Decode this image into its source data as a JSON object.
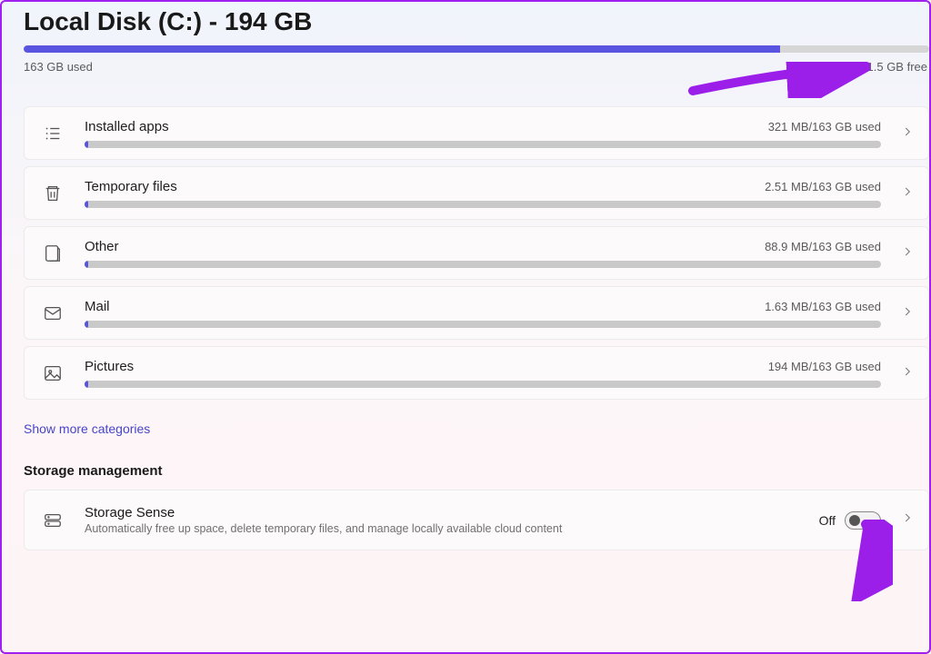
{
  "title": "Local Disk (C:) - 194 GB",
  "usage": {
    "used_label": "163 GB used",
    "free_label": "31.5 GB free",
    "used_pct": 83.5
  },
  "categories": [
    {
      "icon": "apps",
      "name": "Installed apps",
      "value": "321 MB/163 GB used",
      "pct": 0.2
    },
    {
      "icon": "trash",
      "name": "Temporary files",
      "value": "2.51 MB/163 GB used",
      "pct": 0.02
    },
    {
      "icon": "other",
      "name": "Other",
      "value": "88.9 MB/163 GB used",
      "pct": 0.06
    },
    {
      "icon": "mail",
      "name": "Mail",
      "value": "1.63 MB/163 GB used",
      "pct": 0.01
    },
    {
      "icon": "pictures",
      "name": "Pictures",
      "value": "194 MB/163 GB used",
      "pct": 0.13
    }
  ],
  "show_more": "Show more categories",
  "section_heading": "Storage management",
  "storage_sense": {
    "title": "Storage Sense",
    "desc": "Automatically free up space, delete temporary files, and manage locally available cloud content",
    "state": "Off"
  }
}
